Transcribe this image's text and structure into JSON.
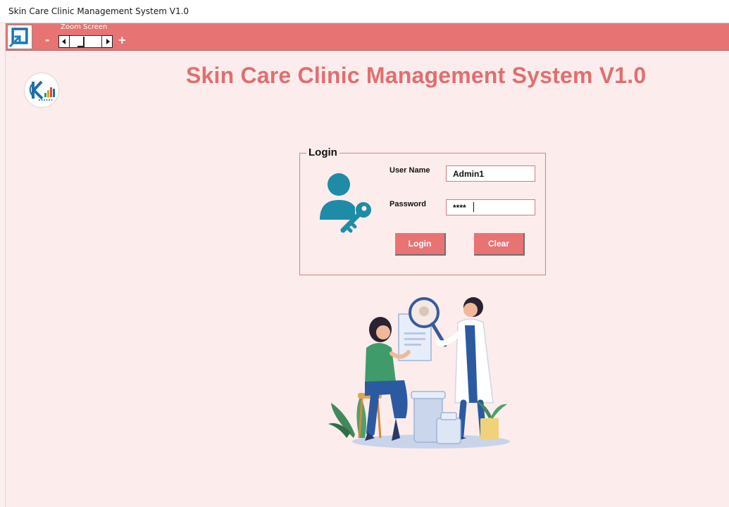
{
  "window": {
    "title": "Skin Care Clinic Management System V1.0"
  },
  "toolbar": {
    "app_icon": "restore-window-icon",
    "zoom_label": "Zoom Screen",
    "zoom_minus": "-",
    "zoom_plus": "+"
  },
  "header": {
    "logo": "clinic-logo",
    "title": "Skin Care Clinic Management System V1.0"
  },
  "login": {
    "legend": "Login",
    "icon": "user-key-icon",
    "username_label": "User Name",
    "username_value": "Admin1",
    "password_label": "Password",
    "password_value": "****",
    "login_button": "Login",
    "clear_button": "Clear"
  },
  "illustration": "doctor-patient-illustration",
  "colors": {
    "accent": "#e87373",
    "title": "#e06f6f",
    "background": "#fcecec",
    "icon": "#1e8ca6"
  }
}
